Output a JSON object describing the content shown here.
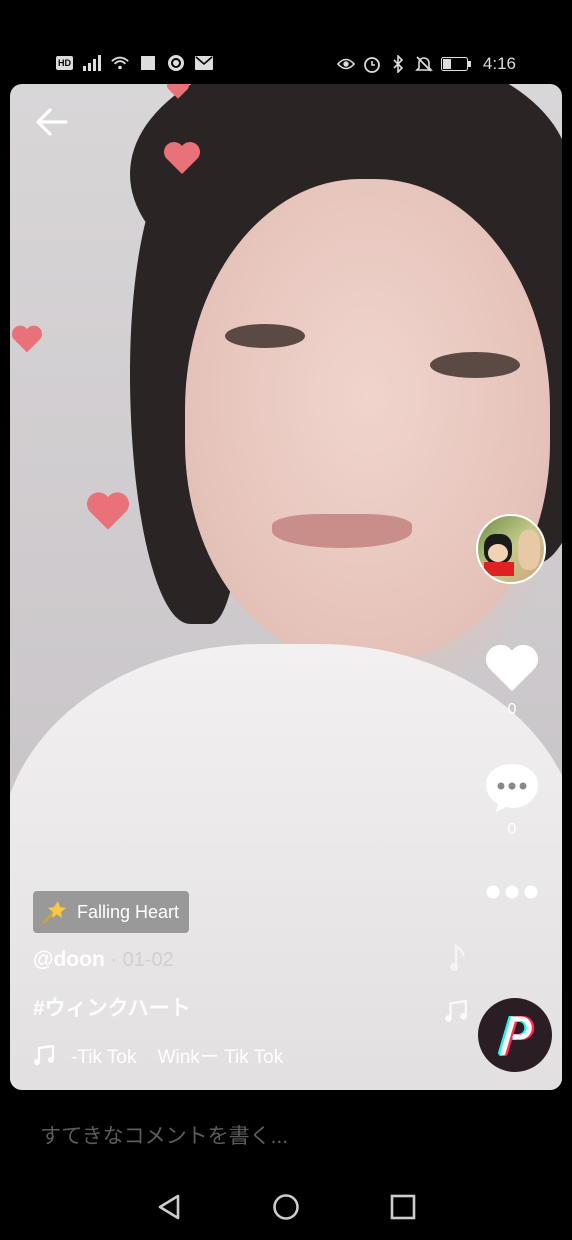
{
  "status_bar": {
    "hd_label": "HD",
    "time": "4:16",
    "left_icons": [
      "signal-icon",
      "wifi-icon",
      "square-icon",
      "sync-icon",
      "mail-icon"
    ],
    "right_icons": [
      "eye-icon",
      "alarm-icon",
      "bluetooth-icon",
      "mute-icon",
      "battery-icon"
    ]
  },
  "video": {
    "effect_label": "Falling Heart",
    "author": "@doon",
    "date": " · 01-02",
    "hashtag": "#ウィンクハート",
    "music_text": "-Tik Tok    Winkー Tik Tok",
    "like_count": "0",
    "comment_count": "0"
  },
  "comment": {
    "placeholder": "すてきなコメントを書く..."
  },
  "colors": {
    "heart_pink": "#e8717a",
    "accent_red": "#ff2d55",
    "accent_cyan": "#25f4ee"
  }
}
